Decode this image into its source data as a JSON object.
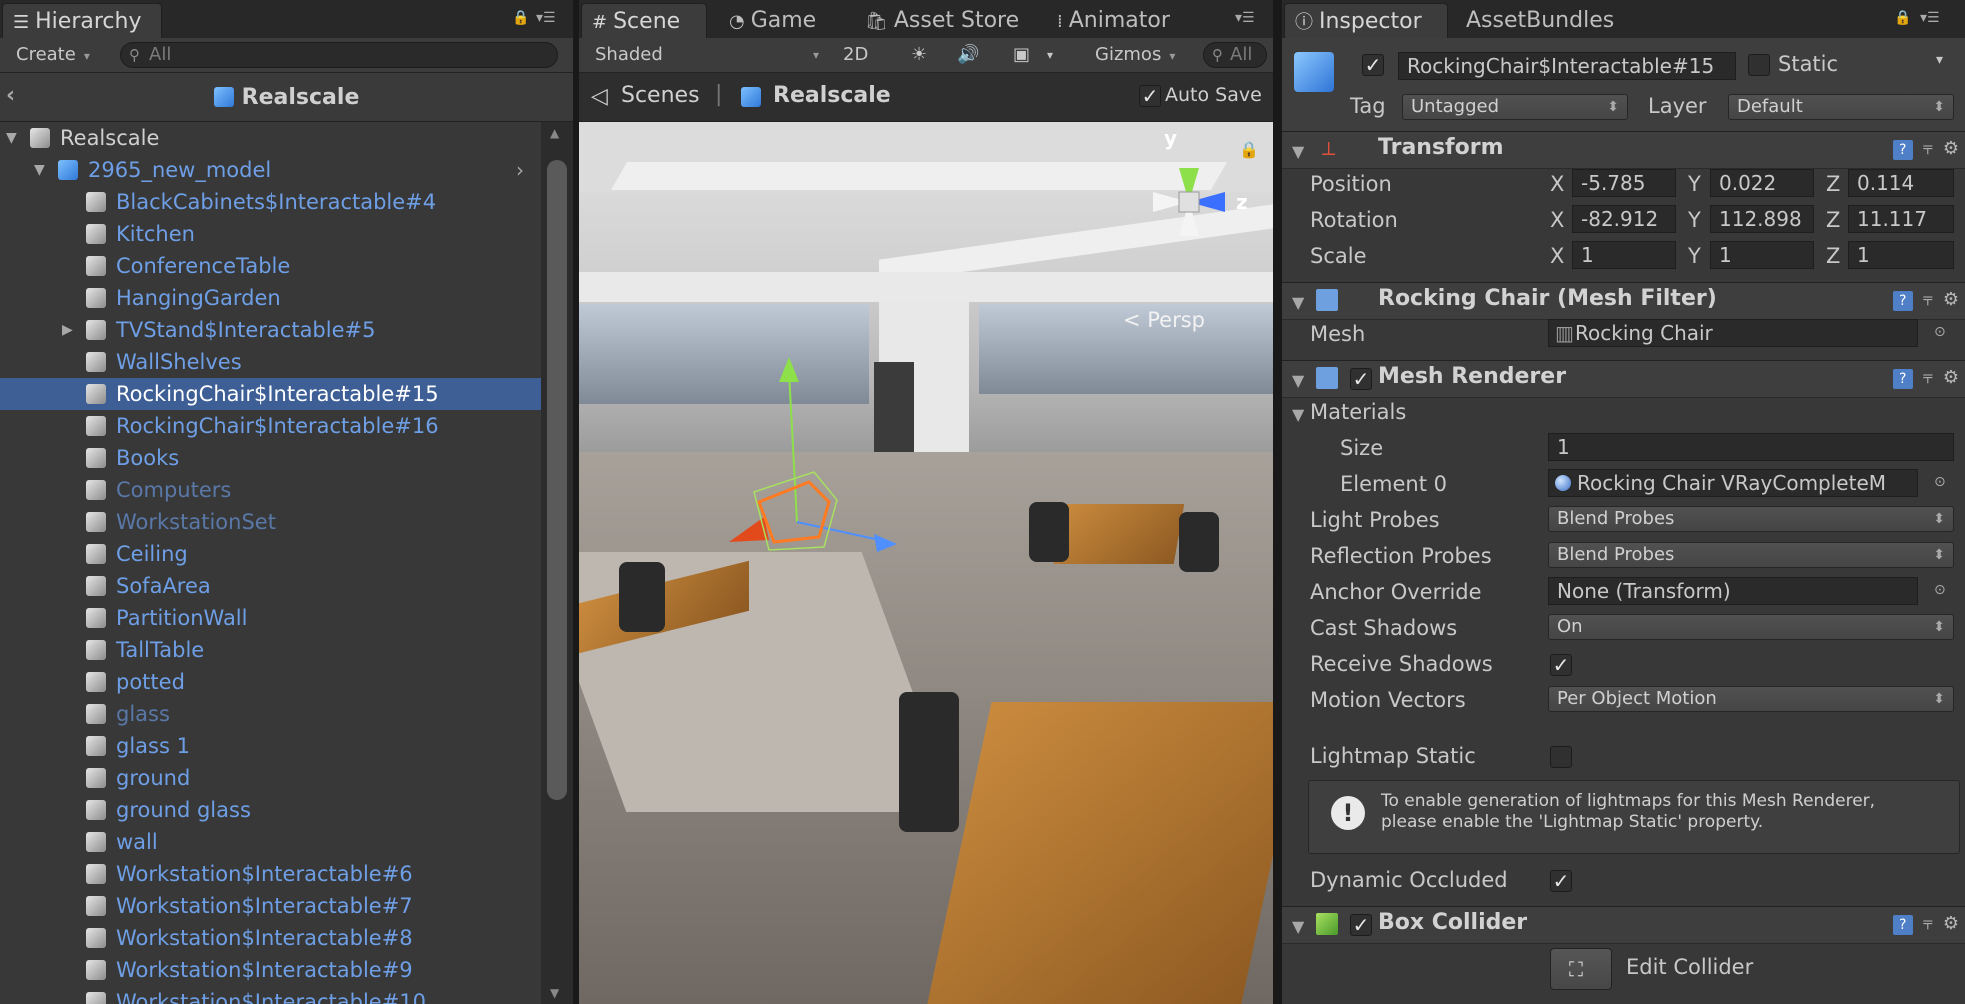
{
  "hierarchy": {
    "tab_label": "Hierarchy",
    "create_label": "Create",
    "search_placeholder": "All",
    "scene_title": "Realscale",
    "items": [
      {
        "label": "Realscale",
        "kind": "plain"
      },
      {
        "label": "2965_new_model",
        "kind": "prefab"
      },
      {
        "label": "BlackCabinets$Interactable#4",
        "kind": "prefab"
      },
      {
        "label": "Kitchen",
        "kind": "prefab"
      },
      {
        "label": "ConferenceTable",
        "kind": "prefab"
      },
      {
        "label": "HangingGarden",
        "kind": "prefab"
      },
      {
        "label": "TVStand$Interactable#5",
        "kind": "prefab"
      },
      {
        "label": "WallShelves",
        "kind": "prefab"
      },
      {
        "label": "RockingChair$Interactable#15",
        "kind": "prefab",
        "selected": true
      },
      {
        "label": "RockingChair$Interactable#16",
        "kind": "prefab"
      },
      {
        "label": "Books",
        "kind": "prefab"
      },
      {
        "label": "Computers",
        "kind": "prefab-dim"
      },
      {
        "label": "WorkstationSet",
        "kind": "prefab-dim"
      },
      {
        "label": "Ceiling",
        "kind": "prefab"
      },
      {
        "label": "SofaArea",
        "kind": "prefab"
      },
      {
        "label": "PartitionWall",
        "kind": "prefab"
      },
      {
        "label": "TallTable",
        "kind": "prefab"
      },
      {
        "label": "potted",
        "kind": "prefab"
      },
      {
        "label": "glass",
        "kind": "prefab-dim"
      },
      {
        "label": "glass 1",
        "kind": "prefab"
      },
      {
        "label": "ground",
        "kind": "prefab"
      },
      {
        "label": "ground glass",
        "kind": "prefab"
      },
      {
        "label": "wall",
        "kind": "prefab"
      },
      {
        "label": "Workstation$Interactable#6",
        "kind": "prefab"
      },
      {
        "label": "Workstation$Interactable#7",
        "kind": "prefab"
      },
      {
        "label": "Workstation$Interactable#8",
        "kind": "prefab"
      },
      {
        "label": "Workstation$Interactable#9",
        "kind": "prefab"
      },
      {
        "label": "Workstation$Interactable#10",
        "kind": "prefab"
      }
    ]
  },
  "scene": {
    "tabs": {
      "scene": "Scene",
      "game": "Game",
      "asset_store": "Asset Store",
      "animator": "Animator"
    },
    "toolbar": {
      "shading": "Shaded",
      "mode_2d": "2D",
      "gizmos": "Gizmos",
      "search_placeholder": "All"
    },
    "breadcrumb": {
      "root": "Scenes",
      "current": "Realscale"
    },
    "auto_save_label": "Auto Save",
    "auto_save_checked": true,
    "projection_label": "< Persp",
    "axis_labels": {
      "y": "y",
      "z": "z"
    }
  },
  "inspector": {
    "tabs": {
      "inspector": "Inspector",
      "asset_bundles": "AssetBundles"
    },
    "object_name": "RockingChair$Interactable#15",
    "active": true,
    "static_label": "Static",
    "tag_label": "Tag",
    "tag_value": "Untagged",
    "layer_label": "Layer",
    "layer_value": "Default",
    "transform": {
      "title": "Transform",
      "position_label": "Position",
      "rotation_label": "Rotation",
      "scale_label": "Scale",
      "position": {
        "x": "-5.785",
        "y": "0.022",
        "z": "0.114"
      },
      "rotation": {
        "x": "-82.912",
        "y": "112.898",
        "z": "11.117"
      },
      "scale": {
        "x": "1",
        "y": "1",
        "z": "1"
      }
    },
    "mesh_filter": {
      "title": "Rocking Chair  (Mesh Filter)",
      "mesh_label": "Mesh",
      "mesh_value": "Rocking Chair"
    },
    "mesh_renderer": {
      "title": "Mesh Renderer",
      "materials_label": "Materials",
      "size_label": "Size",
      "size_value": "1",
      "element0_label": "Element 0",
      "element0_value": "Rocking Chair VRayCompleteM",
      "light_probes_label": "Light Probes",
      "light_probes_value": "Blend Probes",
      "reflection_probes_label": "Reflection Probes",
      "reflection_probes_value": "Blend Probes",
      "anchor_override_label": "Anchor Override",
      "anchor_override_value": "None (Transform)",
      "cast_shadows_label": "Cast Shadows",
      "cast_shadows_value": "On",
      "receive_shadows_label": "Receive Shadows",
      "receive_shadows_checked": true,
      "motion_vectors_label": "Motion Vectors",
      "motion_vectors_value": "Per Object Motion",
      "lightmap_static_label": "Lightmap Static",
      "lightmap_static_checked": false,
      "help_line1": "To enable generation of lightmaps for this Mesh Renderer,",
      "help_line2": "please enable the 'Lightmap Static' property.",
      "dynamic_occluded_label": "Dynamic Occluded",
      "dynamic_occluded_checked": true
    },
    "box_collider": {
      "title": "Box Collider",
      "edit_label": "Edit Collider"
    },
    "axis": {
      "x": "X",
      "y": "Y",
      "z": "Z"
    }
  },
  "colors": {
    "selection": "#3e5f96",
    "prefab_text": "#6e9fe6",
    "panel_bg": "#383838"
  }
}
